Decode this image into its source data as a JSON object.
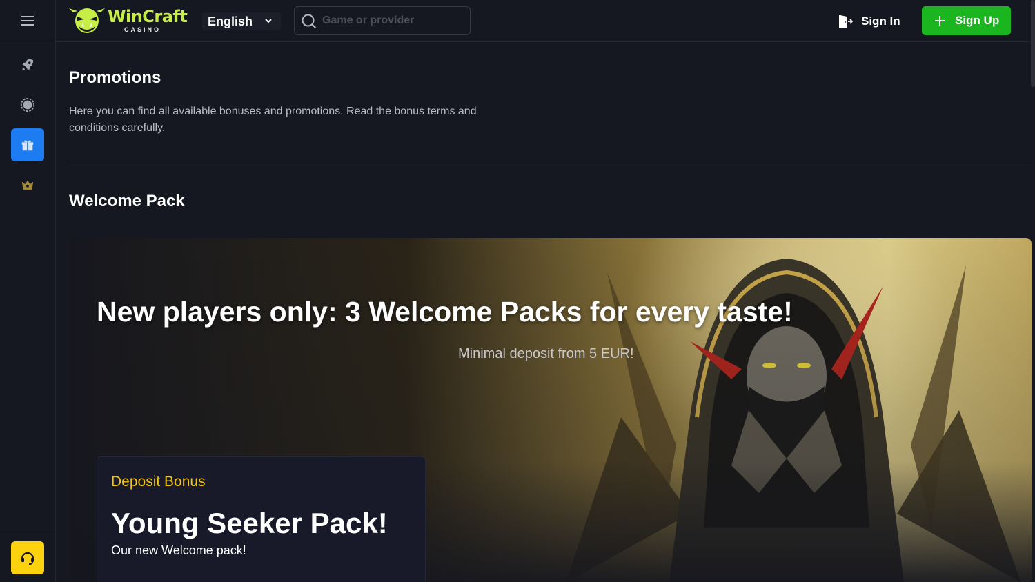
{
  "brand": {
    "name": "WinCraft",
    "sub": "CASINO",
    "accent": "#c6ee47"
  },
  "header": {
    "language": "English",
    "search_placeholder": "Game or provider",
    "signin_label": "Sign In",
    "signup_label": "Sign Up",
    "signup_color": "#1bb520"
  },
  "sidebar": {
    "items": [
      {
        "icon": "rocket-icon",
        "active": false
      },
      {
        "icon": "casino-chip-icon",
        "active": false
      },
      {
        "icon": "gift-icon",
        "active": true
      },
      {
        "icon": "crown-icon",
        "active": false
      }
    ],
    "support_icon": "headset-icon",
    "active_color": "#1e7cf2",
    "support_color": "#fcd20f"
  },
  "page": {
    "title": "Promotions",
    "description": "Here you can find all available bonuses and promotions. Read the bonus terms and conditions carefully.",
    "section_title": "Welcome Pack"
  },
  "banner": {
    "headline": "New players only: 3 Welcome Packs for every taste!",
    "subtext": "Minimal deposit from 5 EUR!",
    "card": {
      "tag": "Deposit Bonus",
      "title": "Young Seeker Pack!",
      "description": "Our new Welcome pack!"
    }
  }
}
